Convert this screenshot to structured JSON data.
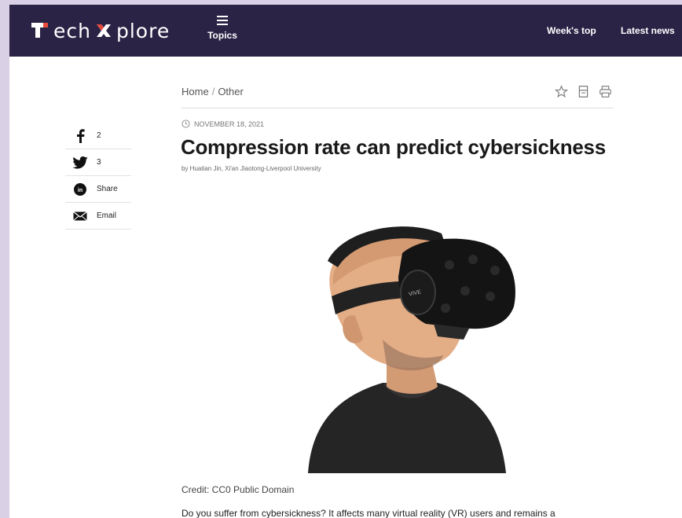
{
  "header": {
    "logo_text": "ech",
    "logo_text_2": "plore",
    "topics_label": "Topics",
    "nav": [
      "Week's top",
      "Latest news"
    ]
  },
  "breadcrumb": {
    "home": "Home",
    "separator": "/",
    "section": "Other"
  },
  "article": {
    "date": "NOVEMBER 18, 2021",
    "title": "Compression rate can predict cybersickness",
    "byline": "by Huatian Jin, Xi'an Jiaotong-Liverpool University",
    "image_credit": "Credit: CC0 Public Domain",
    "lede": "Do you suffer from cybersickness? It affects many virtual reality (VR) users and remains a"
  },
  "share": [
    {
      "icon": "facebook-icon",
      "text": "2"
    },
    {
      "icon": "twitter-icon",
      "text": "3"
    },
    {
      "icon": "linkedin-icon",
      "text": "Share"
    },
    {
      "icon": "email-icon",
      "text": "Email"
    }
  ],
  "tools": [
    "star-icon",
    "save-icon",
    "print-icon"
  ],
  "colors": {
    "header_bg": "#2b2346",
    "logo_accent": "#e84a3c",
    "outer_bg": "#d9d0e6"
  }
}
